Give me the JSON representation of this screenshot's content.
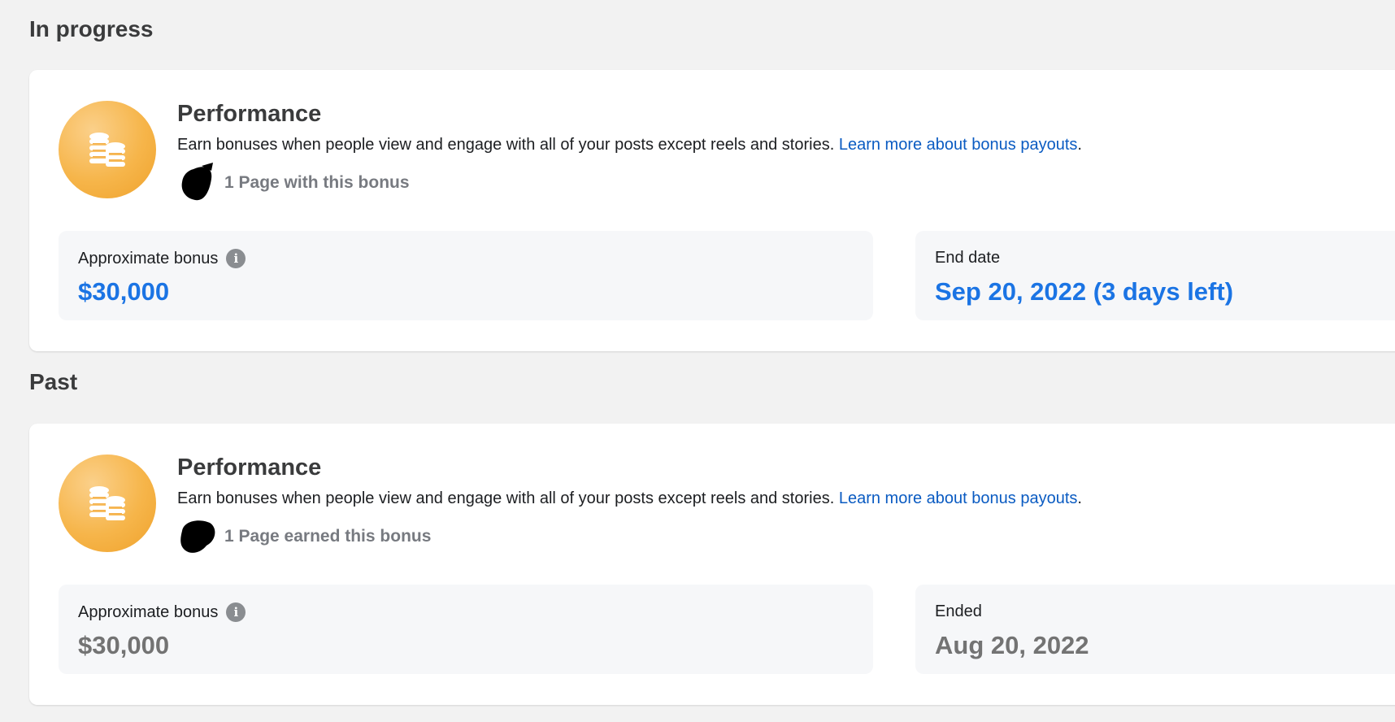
{
  "sections": {
    "in_progress": {
      "heading": "In progress",
      "card": {
        "icon": "coins-icon",
        "title": "Performance",
        "description": "Earn bonuses when people view and engage with all of your posts except reels and stories.",
        "link_text": "Learn more about bonus payouts",
        "link_suffix": ".",
        "page_status": "1 Page with this bonus",
        "bonus_label": "Approximate bonus",
        "bonus_value": "$30,000",
        "date_label": "End date",
        "date_value": "Sep 20, 2022 (3 days left)"
      }
    },
    "past": {
      "heading": "Past",
      "card": {
        "icon": "coins-icon",
        "title": "Performance",
        "description": "Earn bonuses when people view and engage with all of your posts except reels and stories.",
        "link_text": "Learn more about bonus payouts",
        "link_suffix": ".",
        "page_status": "1 Page earned this bonus",
        "bonus_label": "Approximate bonus",
        "bonus_value": "$30,000",
        "date_label": "Ended",
        "date_value": "Aug 20, 2022"
      }
    }
  },
  "colors": {
    "background": "#f2f2f2",
    "card": "#ffffff",
    "link": "#0a5bc2",
    "active_value": "#1b74e4",
    "past_value": "#737373",
    "coin_badge": "#f6b54a"
  }
}
